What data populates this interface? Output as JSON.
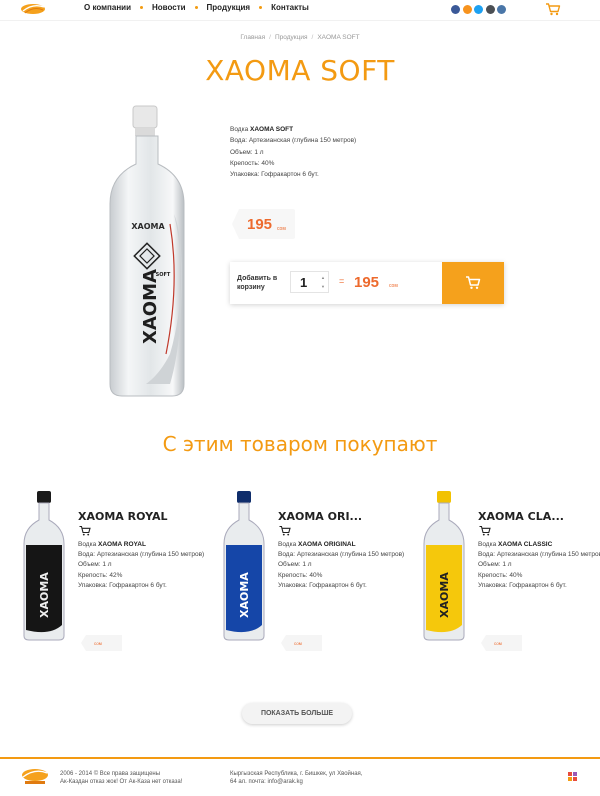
{
  "nav": {
    "items": [
      "О компании",
      "Новости",
      "Продукция",
      "Контакты"
    ]
  },
  "social": {
    "icons": [
      "facebook-icon",
      "odnoklassniki-icon",
      "twitter-icon",
      "instagram-icon",
      "vk-icon"
    ],
    "colors": [
      "#3b5998",
      "#f7931e",
      "#1da1f2",
      "#4b4f54",
      "#4a76a8"
    ]
  },
  "colors": {
    "accent": "#f39a12",
    "price": "#ed6a2d",
    "button": "#f5a11c"
  },
  "breadcrumb": [
    "Главная",
    "Продукция",
    "XAOMA SOFT"
  ],
  "product": {
    "title": "XAOMA SOFT",
    "specs": {
      "name_prefix": "Водка ",
      "name": "XAOMA SOFT",
      "water": "Вода: Артезианская (глубина 150 метров)",
      "volume": "Объем: 1 л",
      "strength": "Крепость: 40%",
      "package": "Упаковка: Гофракартон 6 бут."
    },
    "price": "195",
    "currency": "сом",
    "add_to_cart_label": "Добавить в корзину",
    "quantity": "1",
    "equals": "=",
    "total": "195",
    "total_currency": "сом"
  },
  "related": {
    "title": "С этим товаром покупают",
    "items": [
      {
        "title": "XAOMA ROYAL",
        "name_prefix": "Водка ",
        "name": "XAOMA ROYAL",
        "water": "Вода: Артезианская (глубина 150 метров)",
        "volume": "Объем: 1 л",
        "strength": "Крепость: 42%",
        "package": "Упаковка: Гофракартон 6 бут.",
        "currency": "сом"
      },
      {
        "title": "XAOMA ORI...",
        "name_prefix": "Водка ",
        "name": "XAOMA ORIGINAL",
        "water": "Вода: Артезианская (глубина 150 метров)",
        "volume": "Объем: 1 л",
        "strength": "Крепость: 40%",
        "package": "Упаковка: Гофракартон 6 бут.",
        "currency": "сом"
      },
      {
        "title": "XAOMA CLA...",
        "name_prefix": "Водка ",
        "name": "XAOMA CLASSIC",
        "water": "Вода: Артезианская (глубина 150 метров)",
        "volume": "Объем: 1 л",
        "strength": "Крепость: 40%",
        "package": "Упаковка: Гофракартон 6 бут.",
        "currency": "сом"
      }
    ],
    "more_button": "ПОКАЗАТЬ БОЛЬШЕ"
  },
  "footer": {
    "copyright_line1": "2006 - 2014 © Все права защищены",
    "copyright_line2": "Ак-Каздан отказ жок! От Ак-Каза нет отказа!",
    "address_line1": "Кыргызская Республика, г. Бишкек, ул Хвойная,",
    "address_line2": "64 ал. почта: info@arak.kg"
  }
}
